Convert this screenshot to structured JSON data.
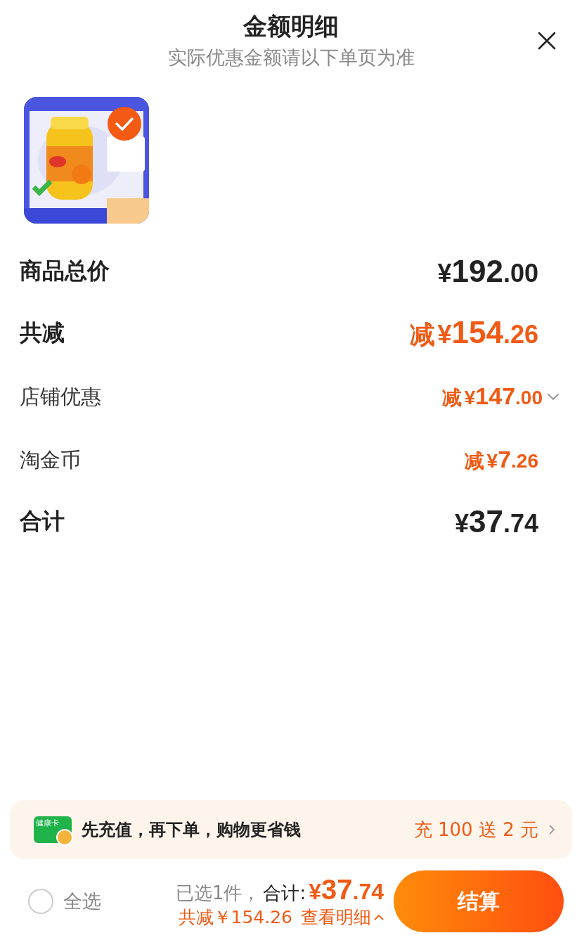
{
  "header": {
    "title": "金额明细",
    "subtitle": "实际优惠金额请以下单页为准"
  },
  "product": {
    "selected": true
  },
  "rows": [
    {
      "kind": "main",
      "label": "商品总价",
      "prefix": "",
      "currency": "¥",
      "integer": "192",
      "decimals": ".00",
      "discount": false
    },
    {
      "kind": "main",
      "label": "共减",
      "prefix": "减",
      "currency": "¥",
      "integer": "154",
      "decimals": ".26",
      "discount": true
    },
    {
      "kind": "sub",
      "label": "店铺优惠",
      "prefix": "减",
      "currency": "¥",
      "integer": "147",
      "decimals": ".00",
      "discount": true,
      "expanded": false
    },
    {
      "kind": "sub",
      "label": "淘金币",
      "prefix": "减",
      "currency": "¥",
      "integer": "7",
      "decimals": ".26",
      "discount": true
    },
    {
      "kind": "main",
      "label": "合计",
      "prefix": "",
      "currency": "¥",
      "integer": "37",
      "decimals": ".74",
      "discount": false
    }
  ],
  "promo": {
    "card_label": "健康卡",
    "text": "先充值，再下单，购物更省钱",
    "offer": "充 100 送 2 元"
  },
  "footer": {
    "select_all": {
      "label": "全选",
      "checked": false
    },
    "selected_count": "已选1件，",
    "total_label": "合计:",
    "currency": "¥",
    "integer": "37",
    "decimals": ".74",
    "saving": "共减￥154.26",
    "details": "查看明细",
    "details_expanded": false,
    "checkout": "结算"
  }
}
